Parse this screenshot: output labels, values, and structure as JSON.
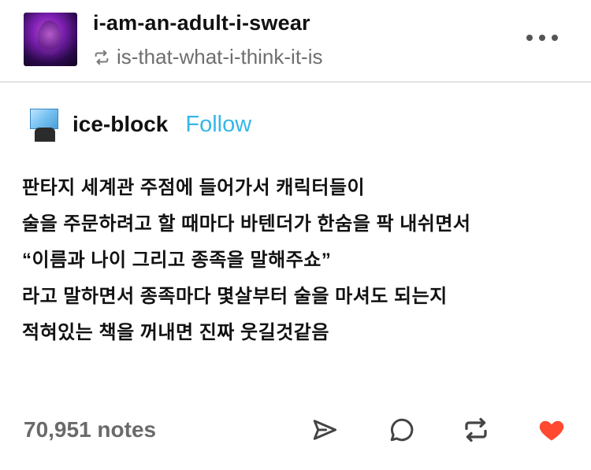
{
  "header": {
    "blog_name": "i-am-an-adult-i-swear",
    "reblogged_from": "is-that-what-i-think-it-is",
    "avatar_icon": "blog-avatar",
    "reblog_icon": "reblog-icon",
    "more_icon": "more-options-icon"
  },
  "post": {
    "op_name": "ice-block",
    "follow_label": "Follow",
    "accent_color": "#35b7e8",
    "lines": [
      "판타지 세계관 주점에 들어가서 캐릭터들이",
      "술을 주문하려고 할 때마다 바텐더가 한숨을 팍 내쉬면서",
      "“이름과 나이 그리고 종족을 말해주쇼”",
      "라고 말하면서 종족마다 몇살부터 술을 마셔도 되는지",
      "적혀있는 책을 꺼내면 진짜 웃길것같음"
    ]
  },
  "footer": {
    "notes": "70,951 notes",
    "icons": [
      "share-icon",
      "reply-icon",
      "reblog-icon",
      "heart-icon"
    ],
    "like_color": "#ff4930"
  }
}
